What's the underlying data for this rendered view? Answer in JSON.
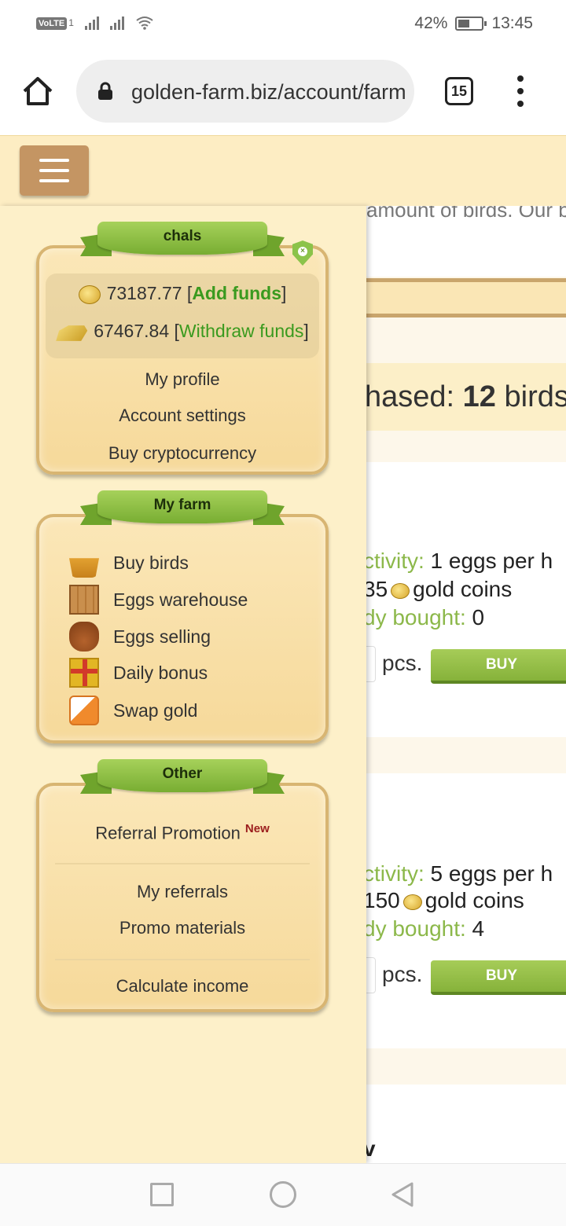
{
  "status": {
    "volte": "VoLTE",
    "sim": "1",
    "battery": "42%",
    "time": "13:45"
  },
  "browser": {
    "url": "golden-farm.biz/account/farm",
    "tabs_count": "15"
  },
  "background": {
    "top_text": "amount of birds. Our bi",
    "purchased_prefix": "hased: ",
    "purchased_count": "12",
    "purchased_suffix": " birds",
    "cards": [
      {
        "activity_label": "ctivity:",
        "activity_value": " 1 eggs per h",
        "price_value": "35",
        "price_suffix": "gold coins",
        "bought_label": "dy bought:",
        "bought_value": " 0",
        "pcs": "pcs.",
        "buy": "BUY"
      },
      {
        "activity_label": "ctivity:",
        "activity_value": " 5 eggs per h",
        "price_value": "150",
        "price_suffix": "gold coins",
        "bought_label": "dy bought:",
        "bought_value": " 4",
        "pcs": "pcs.",
        "buy": "BUY"
      }
    ],
    "bottom_fragment": "v"
  },
  "profile": {
    "username": "chals",
    "coins": "73187.77",
    "add_funds": "Add funds",
    "gold": "67467.84",
    "withdraw_funds": "Withdraw funds",
    "bracket_open": "[",
    "bracket_close": "]",
    "links": [
      "My profile",
      "Account settings",
      "Buy cryptocurrency"
    ]
  },
  "farm": {
    "title": "My farm",
    "items": [
      {
        "label": "Buy birds",
        "icon": "basket-icon"
      },
      {
        "label": "Eggs warehouse",
        "icon": "crate-icon"
      },
      {
        "label": "Eggs selling",
        "icon": "money-sack-icon"
      },
      {
        "label": "Daily bonus",
        "icon": "gift-icon"
      },
      {
        "label": "Swap gold",
        "icon": "swap-icon"
      }
    ]
  },
  "other": {
    "title": "Other",
    "referral_promotion": "Referral Promotion",
    "new_badge": "New",
    "my_referrals": "My referrals",
    "promo_materials": "Promo materials",
    "calculate_income": "Calculate income"
  },
  "colors": {
    "accent_green": "#8cb84a",
    "header_bg": "#fdedc3",
    "hamburger": "#c49563",
    "new_badge": "#9b1c1c"
  }
}
